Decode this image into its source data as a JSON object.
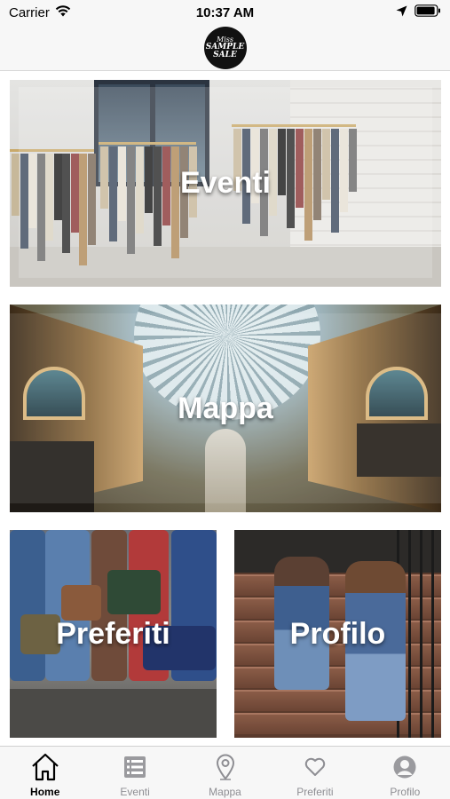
{
  "status_bar": {
    "carrier": "Carrier",
    "time": "10:37 AM"
  },
  "header": {
    "logo_line1": "Miss",
    "logo_line2": "SAMPLE",
    "logo_line3": "SALE"
  },
  "tiles": {
    "eventi": "Eventi",
    "mappa": "Mappa",
    "preferiti": "Preferiti",
    "profilo": "Profilo"
  },
  "tab_bar": {
    "items": [
      {
        "label": "Home",
        "icon": "home-icon",
        "active": true
      },
      {
        "label": "Eventi",
        "icon": "list-icon",
        "active": false
      },
      {
        "label": "Mappa",
        "icon": "map-pin-icon",
        "active": false
      },
      {
        "label": "Preferiti",
        "icon": "heart-icon",
        "active": false
      },
      {
        "label": "Profilo",
        "icon": "user-icon",
        "active": false
      }
    ],
    "active_color": "#000000",
    "inactive_color": "#8e8e93"
  }
}
